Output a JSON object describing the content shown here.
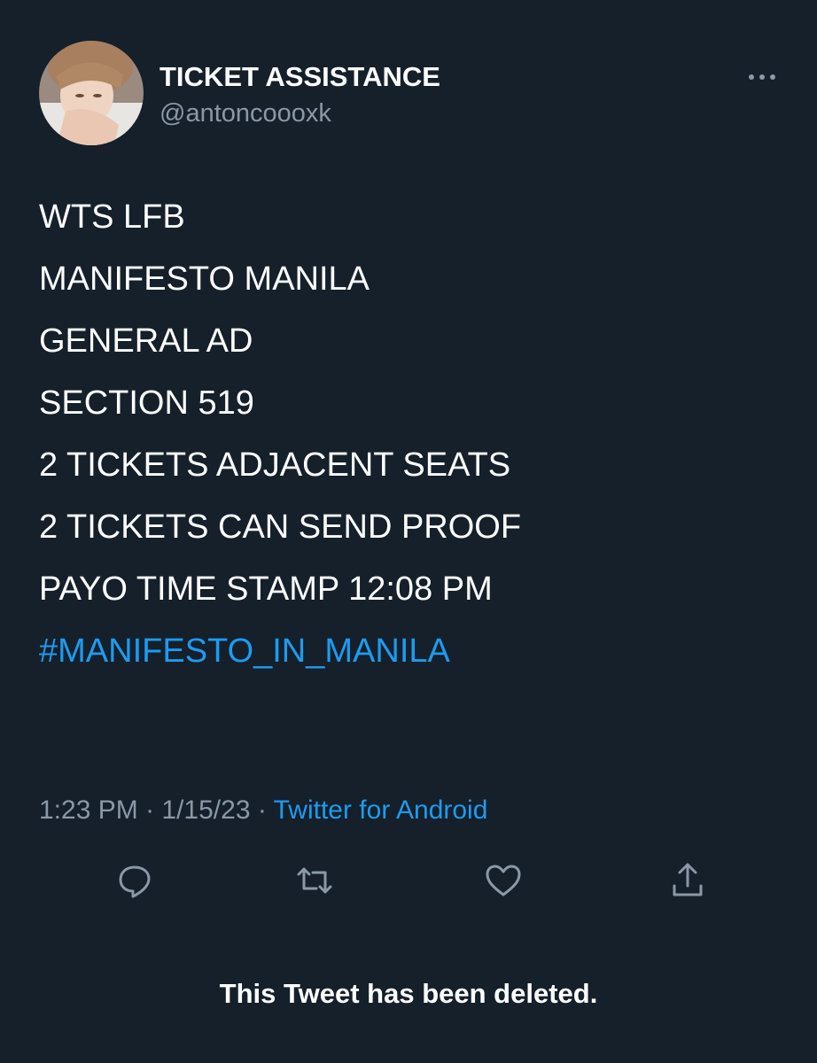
{
  "profile": {
    "display_name": "TICKET ASSISTANCE",
    "handle": "@antoncoooxk",
    "avatar_icon": "profile-photo"
  },
  "tweet": {
    "lines": [
      "WTS LFB",
      "MANIFESTO MANILA",
      "GENERAL AD",
      "SECTION 519",
      "2 TICKETS ADJACENT SEATS",
      "2 TICKETS CAN SEND PROOF",
      "PAYO TIME STAMP 12:08 PM"
    ],
    "hashtag": "#MANIFESTO_IN_MANILA"
  },
  "meta": {
    "time": "1:23 PM",
    "sep1": " · ",
    "date": "1/15/23",
    "sep2": " · ",
    "source": "Twitter for Android"
  },
  "actions": {
    "reply_icon": "reply-icon",
    "retweet_icon": "retweet-icon",
    "like_icon": "heart-icon",
    "share_icon": "share-icon"
  },
  "notice": "This Tweet has been deleted.",
  "colors": {
    "background": "#15202b",
    "text": "#ffffff",
    "muted": "#8b98a5",
    "accent": "#1d9bf0"
  }
}
